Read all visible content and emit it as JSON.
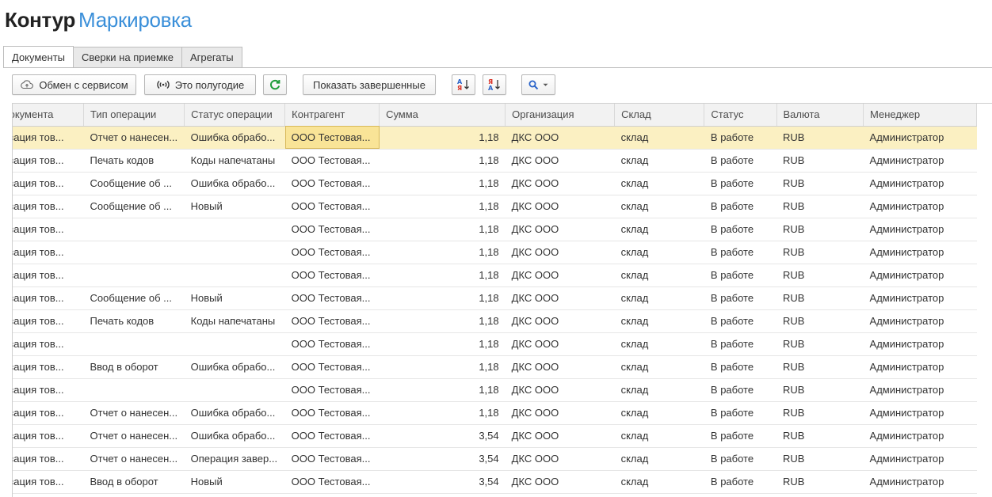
{
  "app": {
    "brand": "Контур",
    "product": "Маркировка",
    "brand_color": "#222222",
    "product_color": "#3a8fd9"
  },
  "tabs": [
    {
      "label": "Документы",
      "active": true
    },
    {
      "label": "Сверки на приемке",
      "active": false
    },
    {
      "label": "Агрегаты",
      "active": false
    }
  ],
  "toolbar": {
    "exchange_label": "Обмен с сервисом",
    "period_label": "Это полугодие",
    "show_completed_label": "Показать завершенные",
    "refresh_icon": "refresh-icon",
    "sort_asc_icon": "sort-asc-icon",
    "sort_desc_icon": "sort-desc-icon",
    "search_icon": "search-icon",
    "accent_color": "#1f9d3a"
  },
  "grid": {
    "columns": [
      "документа",
      "Тип операции",
      "Статус операции",
      "Контрагент",
      "Сумма",
      "Организация",
      "Склад",
      "Статус",
      "Валюта",
      "Менеджер"
    ],
    "selected_row": 0,
    "selection_color": "#fbf0c2",
    "rows": [
      [
        "изация тов...",
        "Отчет о нанесен...",
        "Ошибка обрабо...",
        "ООО Тестовая...",
        "1,18",
        "ДКС ООО",
        "склад",
        "В работе",
        "RUB",
        "Администратор"
      ],
      [
        "изация тов...",
        "Печать кодов",
        "Коды напечатаны",
        "ООО Тестовая...",
        "1,18",
        "ДКС ООО",
        "склад",
        "В работе",
        "RUB",
        "Администратор"
      ],
      [
        "изация тов...",
        "Сообщение об ...",
        "Ошибка обрабо...",
        "ООО Тестовая...",
        "1,18",
        "ДКС ООО",
        "склад",
        "В работе",
        "RUB",
        "Администратор"
      ],
      [
        "изация тов...",
        "Сообщение об ...",
        "Новый",
        "ООО Тестовая...",
        "1,18",
        "ДКС ООО",
        "склад",
        "В работе",
        "RUB",
        "Администратор"
      ],
      [
        "изация тов...",
        "",
        "",
        "ООО Тестовая...",
        "1,18",
        "ДКС ООО",
        "склад",
        "В работе",
        "RUB",
        "Администратор"
      ],
      [
        "изация тов...",
        "",
        "",
        "ООО Тестовая...",
        "1,18",
        "ДКС ООО",
        "склад",
        "В работе",
        "RUB",
        "Администратор"
      ],
      [
        "изация тов...",
        "",
        "",
        "ООО Тестовая...",
        "1,18",
        "ДКС ООО",
        "склад",
        "В работе",
        "RUB",
        "Администратор"
      ],
      [
        "изация тов...",
        "Сообщение об ...",
        "Новый",
        "ООО Тестовая...",
        "1,18",
        "ДКС ООО",
        "склад",
        "В работе",
        "RUB",
        "Администратор"
      ],
      [
        "изация тов...",
        "Печать кодов",
        "Коды напечатаны",
        "ООО Тестовая...",
        "1,18",
        "ДКС ООО",
        "склад",
        "В работе",
        "RUB",
        "Администратор"
      ],
      [
        "изация тов...",
        "",
        "",
        "ООО Тестовая...",
        "1,18",
        "ДКС ООО",
        "склад",
        "В работе",
        "RUB",
        "Администратор"
      ],
      [
        "изация тов...",
        "Ввод в оборот",
        "Ошибка обрабо...",
        "ООО Тестовая...",
        "1,18",
        "ДКС ООО",
        "склад",
        "В работе",
        "RUB",
        "Администратор"
      ],
      [
        "изация тов...",
        "",
        "",
        "ООО Тестовая...",
        "1,18",
        "ДКС ООО",
        "склад",
        "В работе",
        "RUB",
        "Администратор"
      ],
      [
        "изация тов...",
        "Отчет о нанесен...",
        "Ошибка обрабо...",
        "ООО Тестовая...",
        "1,18",
        "ДКС ООО",
        "склад",
        "В работе",
        "RUB",
        "Администратор"
      ],
      [
        "изация тов...",
        "Отчет о нанесен...",
        "Ошибка обрабо...",
        "ООО Тестовая...",
        "3,54",
        "ДКС ООО",
        "склад",
        "В работе",
        "RUB",
        "Администратор"
      ],
      [
        "изация тов...",
        "Отчет о нанесен...",
        "Операция завер...",
        "ООО Тестовая...",
        "3,54",
        "ДКС ООО",
        "склад",
        "В работе",
        "RUB",
        "Администратор"
      ],
      [
        "изация тов...",
        "Ввод в оборот",
        "Новый",
        "ООО Тестовая...",
        "3,54",
        "ДКС ООО",
        "склад",
        "В работе",
        "RUB",
        "Администратор"
      ]
    ]
  }
}
